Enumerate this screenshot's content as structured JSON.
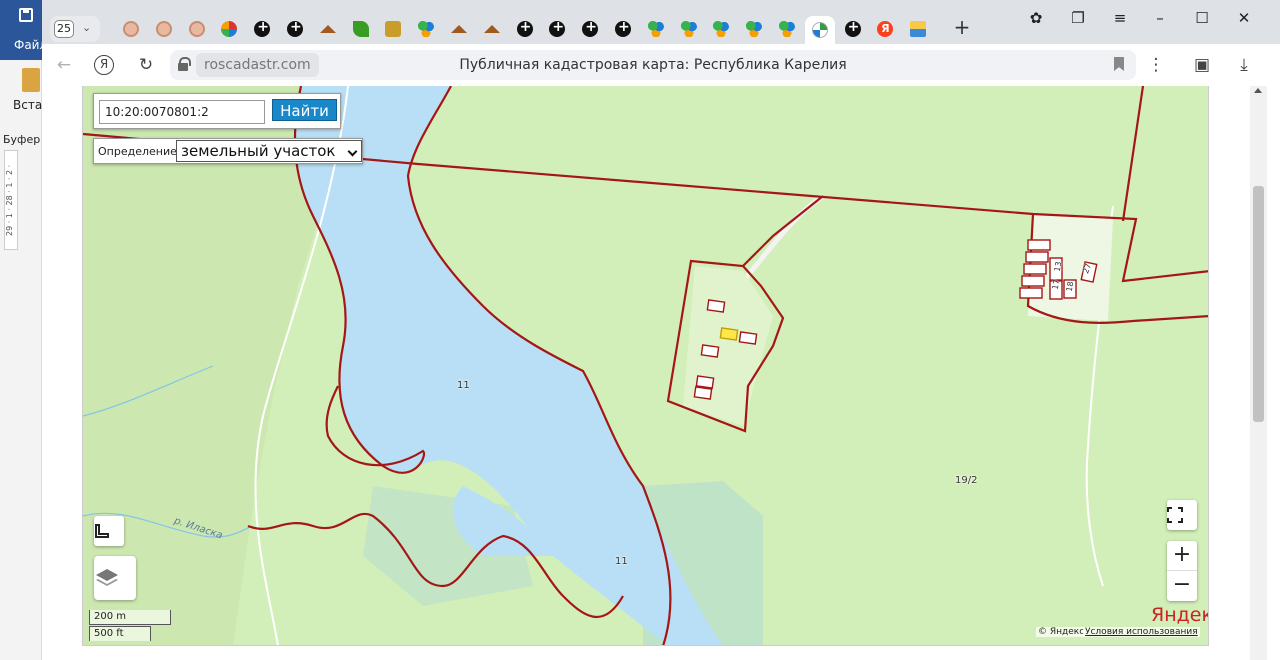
{
  "background_app": {
    "file_label": "Файл",
    "paste_label": "Встав",
    "buffer_label": "Буфер с",
    "ruler_text": "29 · 1 · 28 · 1 · 2 ·"
  },
  "tabs": {
    "count": "25",
    "favicons": [
      "face",
      "face",
      "face",
      "mix",
      "circle",
      "circle",
      "home",
      "leaf",
      "emblem",
      "dots",
      "home",
      "home",
      "circle",
      "circle",
      "circle",
      "circle",
      "dots",
      "dots",
      "dots",
      "dots",
      "dots",
      "cad",
      "circle",
      "ya",
      "pic"
    ],
    "active_index": 21
  },
  "window": {
    "icons": [
      "avatar-icon",
      "collections-icon",
      "menu-icon",
      "minimize-icon",
      "maximize-icon",
      "close-icon"
    ],
    "glyphs": [
      "✿",
      "❐",
      "≡",
      "–",
      "☐",
      "✕"
    ]
  },
  "toolbar": {
    "back_glyph": "←",
    "yandex_glyph": "Я",
    "reload_glyph": "↻",
    "domain": "roscadastr.com",
    "title": "Публичная кадастровая карта: Республика Карелия",
    "more_glyph": "⋮",
    "reading_glyph": "▣",
    "download_glyph": "⤓"
  },
  "map": {
    "search_value": "10:20:0070801:2",
    "search_button": "Найти",
    "definition_label": "Определение:",
    "definition_value": "земельный участок",
    "labels": {
      "zone_11_top": "11",
      "zone_11_bottom": "11",
      "zone_19_2": "19/2",
      "p13": "13",
      "p17": "17",
      "p18": "18",
      "p27": "27"
    },
    "river_name": "р. Иласка",
    "scale_m": "200 m",
    "scale_ft": "500 ft",
    "logo": "Яндекс",
    "copyright": "© Яндекс",
    "terms": "Условия использования",
    "zoom_in": "+",
    "zoom_out": "−",
    "fullscreen_glyph": "⛶",
    "colors": {
      "land": "#d3efb9",
      "water": "#b8dff5",
      "boundary": "#a51616",
      "parcel_highlight": "#ffe74a"
    }
  }
}
